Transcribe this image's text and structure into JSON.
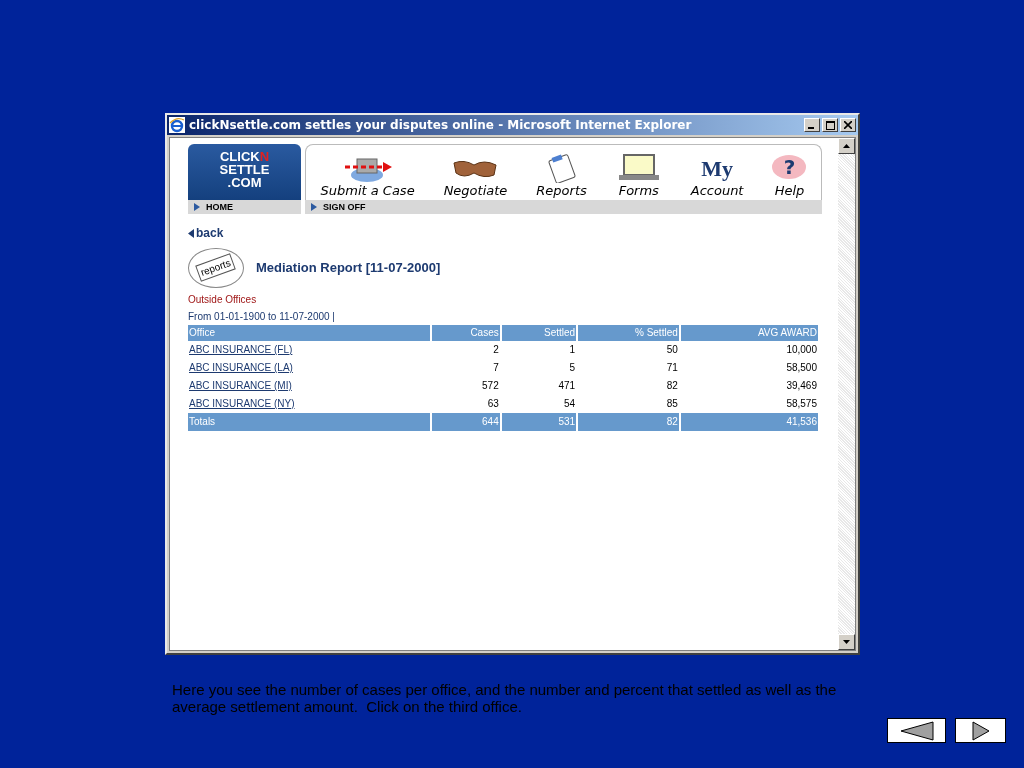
{
  "window": {
    "title": "clickNsettle.com settles your disputes online - Microsoft Internet Explorer"
  },
  "logo": {
    "line_1": "CLICK",
    "accent": "N",
    "line_2": "SETTLE",
    "line_3": ".COM"
  },
  "nav": [
    {
      "label": "Submit a Case",
      "kind": "submit"
    },
    {
      "label": "Negotiate",
      "kind": "negotiate"
    },
    {
      "label": "Reports",
      "kind": "reports"
    },
    {
      "label": "Forms",
      "kind": "forms"
    },
    {
      "label": "Account",
      "kind": "account",
      "badge": "My"
    },
    {
      "label": "Help",
      "kind": "help",
      "badge": "?"
    }
  ],
  "subnav": [
    "HOME",
    "SIGN OFF"
  ],
  "back_link": "back",
  "report": {
    "icon_label": "reports",
    "title": "Mediation Report [11-07-2000]",
    "section": "Outside Offices",
    "range": "From 01-01-1900 to 11-07-2000 |"
  },
  "table": {
    "columns": [
      "Office",
      "Cases",
      "Settled",
      "% Settled",
      "AVG AWARD"
    ],
    "rows": [
      [
        "ABC INSURANCE (FL)",
        "2",
        "1",
        "50",
        "10,000"
      ],
      [
        "ABC INSURANCE (LA)",
        "7",
        "5",
        "71",
        "58,500"
      ],
      [
        "ABC INSURANCE (MI)",
        "572",
        "471",
        "82",
        "39,469"
      ],
      [
        "ABC INSURANCE (NY)",
        "63",
        "54",
        "85",
        "58,575"
      ]
    ],
    "totals": [
      "Totals",
      "644",
      "531",
      "82",
      "41,536"
    ]
  },
  "caption": "Here you see the number of cases per office, and the number and percent that settled as well as the average settlement amount.  Click on the third office."
}
